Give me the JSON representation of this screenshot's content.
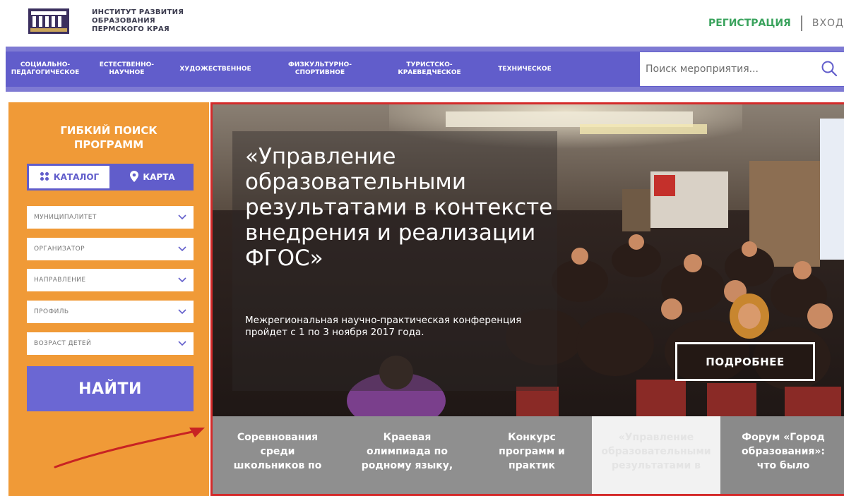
{
  "header": {
    "logo_lines": [
      "ИНСТИТУТ РАЗВИТИЯ",
      "ОБРАЗОВАНИЯ",
      "ПЕРМСКОГО КРАЯ"
    ],
    "register": "РЕГИСТРАЦИЯ",
    "login": "ВХОД"
  },
  "nav": {
    "items": [
      "СОЦИАЛЬНО-\nПЕДАГОГИЧЕСКОЕ",
      "ЕСТЕСТВЕННО-\nНАУЧНОЕ",
      "ХУДОЖЕСТВЕННОЕ",
      "ФИЗКУЛЬТУРНО-\nСПОРТИВНОЕ",
      "ТУРИСТСКО-\nКРАЕВЕДЧЕСКОЕ",
      "ТЕХНИЧЕСКОЕ"
    ],
    "search_placeholder": "Поиск мероприятия..."
  },
  "sidebar": {
    "title": "ГИБКИЙ ПОИСК\nПРОГРАММ",
    "toggle": {
      "catalog": "КАТАЛОГ",
      "map": "КАРТА"
    },
    "filters": [
      "МУНИЦИПАЛИТЕТ",
      "ОРГАНИЗАТОР",
      "НАПРАВЛЕНИЕ",
      "ПРОФИЛЬ",
      "ВОЗРАСТ ДЕТЕЙ"
    ],
    "find": "НАЙТИ"
  },
  "hero": {
    "title": "«Управление образовательными результатами в контексте внедрения и реализации ФГОС»",
    "subtitle": "Межрегиональная научно-практическая конференция пройдет с 1 по 3 ноября 2017 года.",
    "more": "ПОДРОБНЕЕ"
  },
  "tabs": [
    "Соревнования\nсреди\nшкольников по",
    "Краевая\nолимпиада по\nродному языку,",
    "Конкурс\nпрограмм и\nпрактик",
    "«Управление\nобразовательными\nрезультатами в",
    "Форум «Город\nобразования»:\nчто было"
  ],
  "colors": {
    "nav_bg": "#615dcb",
    "sidebar_bg": "#f09a37",
    "register_green": "#3aa35d",
    "highlight_red": "#d42a2a"
  }
}
